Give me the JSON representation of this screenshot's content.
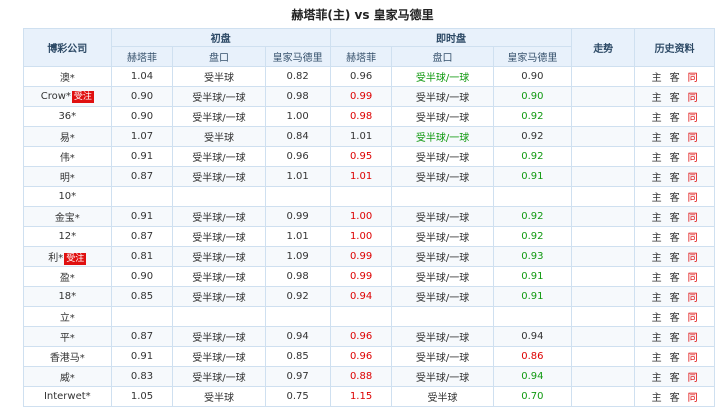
{
  "title": "赫塔菲(主) vs 皇家马德里",
  "colors": {
    "up": "#dd0000",
    "down": "#119911",
    "header_bg": "#e8f1fb",
    "border": "#cfe0f0"
  },
  "headers": {
    "company": "博彩公司",
    "initial": "初盘",
    "live": "即时盘",
    "trend": "走势",
    "history": "历史资料",
    "home": "赫塔菲",
    "handicap": "盘口",
    "away": "皇家马德里"
  },
  "history_links": [
    "主",
    "客",
    "同"
  ],
  "rows": [
    {
      "company": "澳*",
      "tag": "",
      "init": {
        "home": "1.04",
        "hcp": "受半球",
        "away": "0.82"
      },
      "live": {
        "home": "0.96",
        "hcp": "受半球/一球",
        "away": "0.90"
      },
      "live_color": {
        "home": "dark",
        "hcp": "green",
        "away": "dark"
      }
    },
    {
      "company": "Crow*",
      "tag": "受注",
      "init": {
        "home": "0.90",
        "hcp": "受半球/一球",
        "away": "0.98"
      },
      "live": {
        "home": "0.99",
        "hcp": "受半球/一球",
        "away": "0.90"
      },
      "live_color": {
        "home": "red",
        "hcp": "dark",
        "away": "green"
      }
    },
    {
      "company": "36*",
      "tag": "",
      "init": {
        "home": "0.90",
        "hcp": "受半球/一球",
        "away": "1.00"
      },
      "live": {
        "home": "0.98",
        "hcp": "受半球/一球",
        "away": "0.92"
      },
      "live_color": {
        "home": "red",
        "hcp": "dark",
        "away": "green"
      }
    },
    {
      "company": "易*",
      "tag": "",
      "init": {
        "home": "1.07",
        "hcp": "受半球",
        "away": "0.84"
      },
      "live": {
        "home": "1.01",
        "hcp": "受半球/一球",
        "away": "0.92"
      },
      "live_color": {
        "home": "dark",
        "hcp": "green",
        "away": "dark"
      }
    },
    {
      "company": "伟*",
      "tag": "",
      "init": {
        "home": "0.91",
        "hcp": "受半球/一球",
        "away": "0.96"
      },
      "live": {
        "home": "0.95",
        "hcp": "受半球/一球",
        "away": "0.92"
      },
      "live_color": {
        "home": "red",
        "hcp": "dark",
        "away": "green"
      }
    },
    {
      "company": "明*",
      "tag": "",
      "init": {
        "home": "0.87",
        "hcp": "受半球/一球",
        "away": "1.01"
      },
      "live": {
        "home": "1.01",
        "hcp": "受半球/一球",
        "away": "0.91"
      },
      "live_color": {
        "home": "red",
        "hcp": "dark",
        "away": "green"
      }
    },
    {
      "company": "10*",
      "tag": "",
      "init": {
        "home": "",
        "hcp": "",
        "away": ""
      },
      "live": {
        "home": "",
        "hcp": "",
        "away": ""
      },
      "live_color": {
        "home": "dark",
        "hcp": "dark",
        "away": "dark"
      }
    },
    {
      "company": "金宝*",
      "tag": "",
      "init": {
        "home": "0.91",
        "hcp": "受半球/一球",
        "away": "0.99"
      },
      "live": {
        "home": "1.00",
        "hcp": "受半球/一球",
        "away": "0.92"
      },
      "live_color": {
        "home": "red",
        "hcp": "dark",
        "away": "green"
      }
    },
    {
      "company": "12*",
      "tag": "",
      "init": {
        "home": "0.87",
        "hcp": "受半球/一球",
        "away": "1.01"
      },
      "live": {
        "home": "1.00",
        "hcp": "受半球/一球",
        "away": "0.92"
      },
      "live_color": {
        "home": "red",
        "hcp": "dark",
        "away": "green"
      }
    },
    {
      "company": "利*",
      "tag": "受注",
      "init": {
        "home": "0.81",
        "hcp": "受半球/一球",
        "away": "1.09"
      },
      "live": {
        "home": "0.99",
        "hcp": "受半球/一球",
        "away": "0.93"
      },
      "live_color": {
        "home": "red",
        "hcp": "dark",
        "away": "green"
      }
    },
    {
      "company": "盈*",
      "tag": "",
      "init": {
        "home": "0.90",
        "hcp": "受半球/一球",
        "away": "0.98"
      },
      "live": {
        "home": "0.99",
        "hcp": "受半球/一球",
        "away": "0.91"
      },
      "live_color": {
        "home": "red",
        "hcp": "dark",
        "away": "green"
      }
    },
    {
      "company": "18*",
      "tag": "",
      "init": {
        "home": "0.85",
        "hcp": "受半球/一球",
        "away": "0.92"
      },
      "live": {
        "home": "0.94",
        "hcp": "受半球/一球",
        "away": "0.91"
      },
      "live_color": {
        "home": "red",
        "hcp": "dark",
        "away": "green"
      }
    },
    {
      "company": "立*",
      "tag": "",
      "init": {
        "home": "",
        "hcp": "",
        "away": ""
      },
      "live": {
        "home": "",
        "hcp": "",
        "away": ""
      },
      "live_color": {
        "home": "dark",
        "hcp": "dark",
        "away": "dark"
      }
    },
    {
      "company": "平*",
      "tag": "",
      "init": {
        "home": "0.87",
        "hcp": "受半球/一球",
        "away": "0.94"
      },
      "live": {
        "home": "0.96",
        "hcp": "受半球/一球",
        "away": "0.94"
      },
      "live_color": {
        "home": "red",
        "hcp": "dark",
        "away": "dark"
      }
    },
    {
      "company": "香港马*",
      "tag": "",
      "init": {
        "home": "0.91",
        "hcp": "受半球/一球",
        "away": "0.85"
      },
      "live": {
        "home": "0.96",
        "hcp": "受半球/一球",
        "away": "0.86"
      },
      "live_color": {
        "home": "red",
        "hcp": "dark",
        "away": "red"
      }
    },
    {
      "company": "威*",
      "tag": "",
      "init": {
        "home": "0.83",
        "hcp": "受半球/一球",
        "away": "0.97"
      },
      "live": {
        "home": "0.88",
        "hcp": "受半球/一球",
        "away": "0.94"
      },
      "live_color": {
        "home": "red",
        "hcp": "dark",
        "away": "green"
      }
    },
    {
      "company": "Interwet*",
      "tag": "",
      "init": {
        "home": "1.05",
        "hcp": "受半球",
        "away": "0.75"
      },
      "live": {
        "home": "1.15",
        "hcp": "受半球",
        "away": "0.70"
      },
      "live_color": {
        "home": "red",
        "hcp": "dark",
        "away": "green"
      }
    }
  ]
}
